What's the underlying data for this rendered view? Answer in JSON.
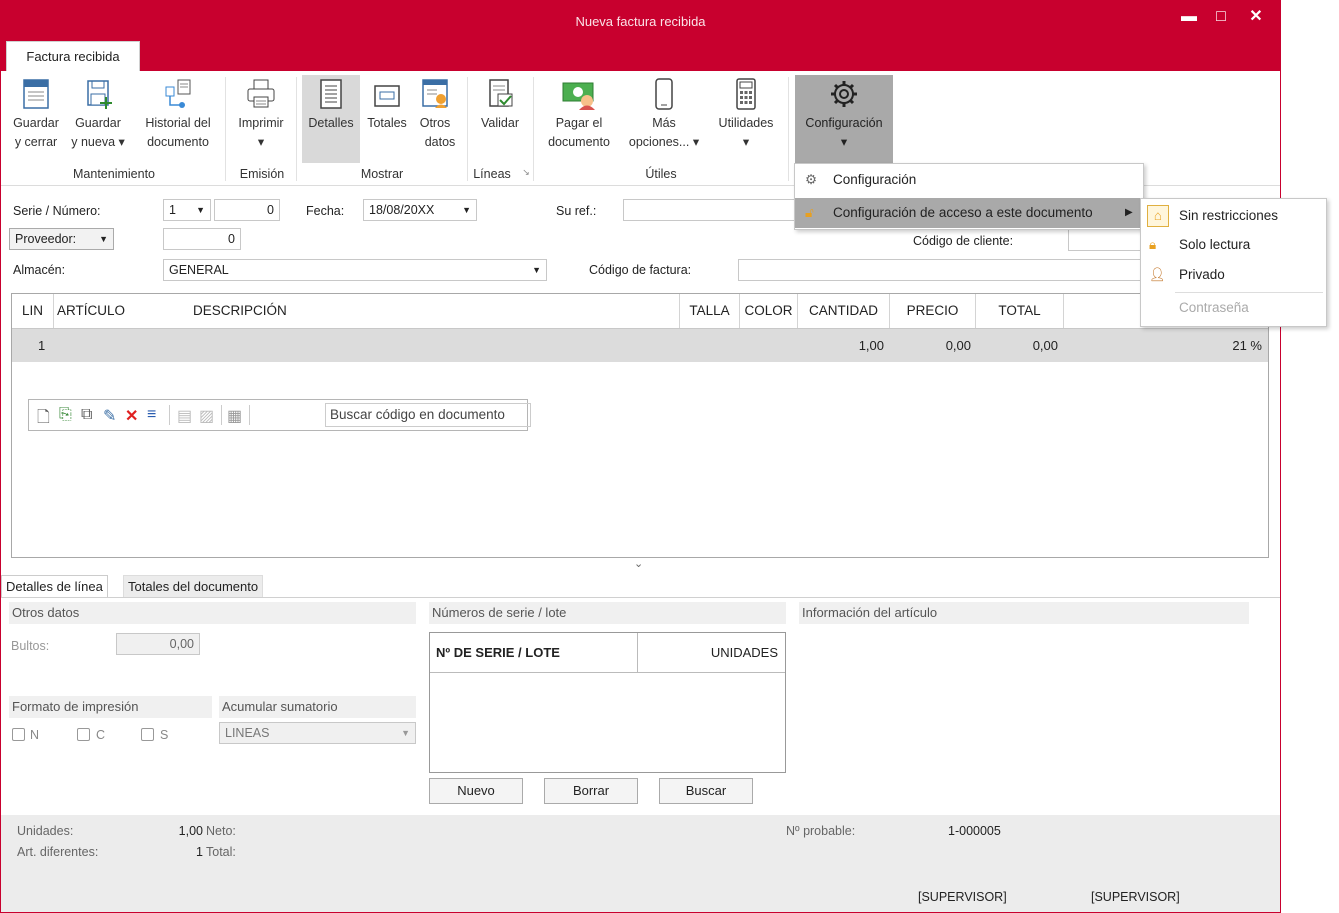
{
  "window": {
    "title": "Nueva factura recibida",
    "minimize": "▬",
    "maximize": "□",
    "close": "✕"
  },
  "tab": "Factura recibida",
  "ribbon": {
    "guardar_cerrar": [
      "Guardar",
      "y cerrar"
    ],
    "guardar_nueva": [
      "Guardar",
      "y nueva ▾"
    ],
    "historial": [
      "Historial del",
      "documento"
    ],
    "imprimir": [
      "Imprimir",
      "▾"
    ],
    "detalles": "Detalles",
    "totales": "Totales",
    "otros_datos": [
      "Otros",
      "datos"
    ],
    "validar": "Validar",
    "pagar": [
      "Pagar el",
      "documento"
    ],
    "mas_opciones": [
      "Más",
      "opciones... ▾"
    ],
    "utilidades": [
      "Utilidades",
      "▾"
    ],
    "configuracion": [
      "Configuración",
      "▾"
    ],
    "groups": {
      "mantenimiento": "Mantenimiento",
      "emision": "Emisión",
      "mostrar": "Mostrar",
      "lineas": "Líneas",
      "utiles": "Útiles"
    }
  },
  "form": {
    "serie_label": "Serie / Número:",
    "serie_value": "1",
    "numero_value": "0",
    "fecha_label": "Fecha:",
    "fecha_value": "18/08/20XX",
    "suref_label": "Su ref.:",
    "proveedor_label": "Proveedor:",
    "proveedor_value": "0",
    "codigo_cliente_label": "Código de cliente:",
    "almacen_label": "Almacén:",
    "almacen_value": "GENERAL",
    "codigo_factura_label": "Código de factura:"
  },
  "grid": {
    "headers": {
      "lin": "LIN",
      "articulo": "ARTÍCULO",
      "descripcion": "DESCRIPCIÓN",
      "talla": "TALLA",
      "color": "COLOR",
      "cantidad": "CANTIDAD",
      "precio": "PRECIO",
      "total": "TOTAL"
    },
    "row": {
      "lin": "1",
      "cantidad": "1,00",
      "precio": "0,00",
      "total": "0,00",
      "iva": "21 %"
    },
    "search_button": "Buscar código en documento"
  },
  "bottom_tabs": {
    "detalles": "Detalles de línea",
    "totales": "Totales del documento"
  },
  "otros": {
    "title": "Otros datos",
    "bultos_label": "Bultos:",
    "bultos_value": "0,00",
    "formato_title": "Formato de impresión",
    "acumular_title": "Acumular sumatorio",
    "check_n": "N",
    "check_c": "C",
    "check_s": "S",
    "acumular_value": "LINEAS"
  },
  "serie_lote": {
    "title": "Números de serie / lote",
    "col1": "Nº DE SERIE / LOTE",
    "col2": "UNIDADES",
    "nuevo": "Nuevo",
    "borrar": "Borrar",
    "buscar": "Buscar"
  },
  "info_articulo": {
    "title": "Información del artículo"
  },
  "status": {
    "unidades_label": "Unidades:",
    "unidades_value": "1,00",
    "neto_label": "Neto:",
    "art_label": "Art. diferentes:",
    "art_value": "1",
    "total_label": "Total:",
    "probable_label": "Nº probable:",
    "probable_value": "1-000005",
    "user1": "[SUPERVISOR]",
    "user2": "[SUPERVISOR]"
  },
  "config_menu": {
    "item1": "Configuración",
    "item2": "Configuración de acceso a este documento"
  },
  "access_menu": {
    "sin": "Sin restricciones",
    "solo": "Solo lectura",
    "privado": "Privado",
    "contrasena": "Contraseña"
  },
  "colors": {
    "accent": "#c8002e",
    "selected": "#a9a9a9"
  }
}
